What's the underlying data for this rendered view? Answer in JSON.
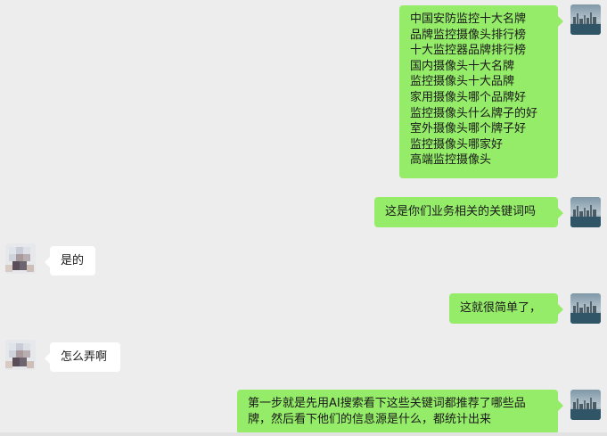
{
  "messages": [
    {
      "sender": "me",
      "lines": [
        "中国安防监控十大名牌",
        "品牌监控摄像头排行榜",
        "十大监控器品牌排行榜",
        "国内摄像头十大名牌",
        "监控摄像头十大品牌",
        "家用摄像头哪个品牌好",
        "监控摄像头什么牌子的好",
        "室外摄像头哪个牌子好",
        "监控摄像头哪家好",
        "高端监控摄像头"
      ]
    },
    {
      "sender": "me",
      "lines": [
        "这是你们业务相关的关键词吗"
      ]
    },
    {
      "sender": "them",
      "lines": [
        "是的"
      ]
    },
    {
      "sender": "me",
      "lines": [
        "这就很简单了，"
      ]
    },
    {
      "sender": "them",
      "lines": [
        "怎么弄啊"
      ]
    },
    {
      "sender": "me",
      "lines": [
        "第一步就是先用AI搜索看下这些关键词都推荐了哪些品",
        "牌，然后看下他们的信息源是什么，都统计出来"
      ]
    }
  ],
  "colors": {
    "background": "#ededed",
    "my_bubble": "#95ec69",
    "their_bubble": "#ffffff",
    "text": "#191919"
  }
}
